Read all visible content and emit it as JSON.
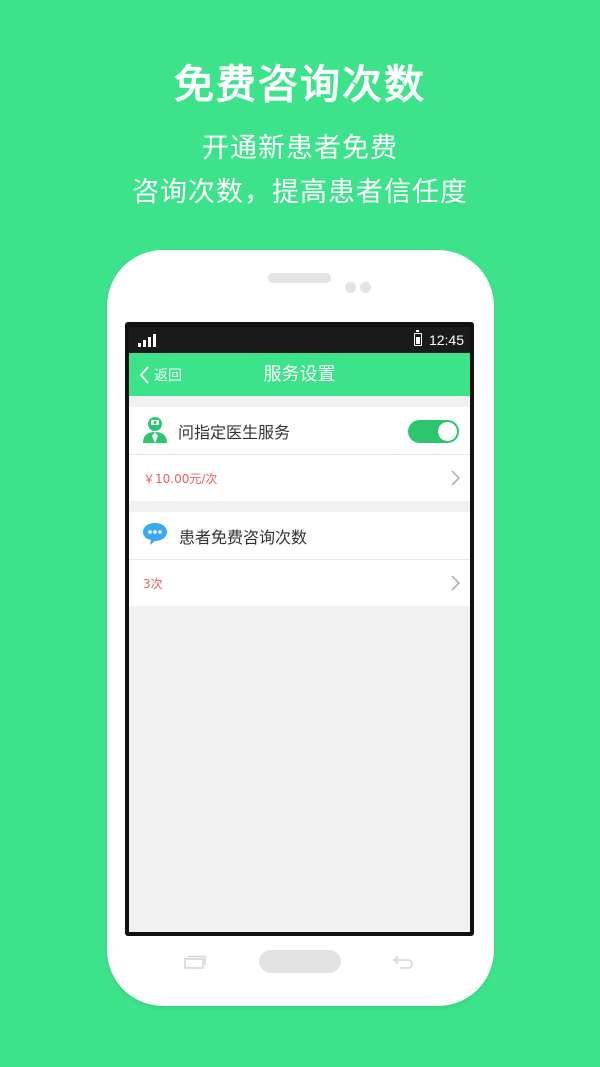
{
  "hero": {
    "title": "免费咨询次数",
    "subtitle_line1": "开通新患者免费",
    "subtitle_line2": "咨询次数，提高患者信任度"
  },
  "statusbar": {
    "time": "12:45"
  },
  "navbar": {
    "back_label": "返回",
    "title": "服务设置"
  },
  "sections": [
    {
      "icon": "doctor-icon",
      "label": "问指定医生服务",
      "toggle_on": true,
      "value": "￥10.00元/次"
    },
    {
      "icon": "chat-bubbles-icon",
      "label": "患者免费咨询次数",
      "value": "3次"
    }
  ],
  "colors": {
    "brand_green": "#3de38b",
    "toggle_green": "#2cc66f",
    "price_red": "#f25b5b",
    "chat_blue": "#3aa8f5"
  }
}
